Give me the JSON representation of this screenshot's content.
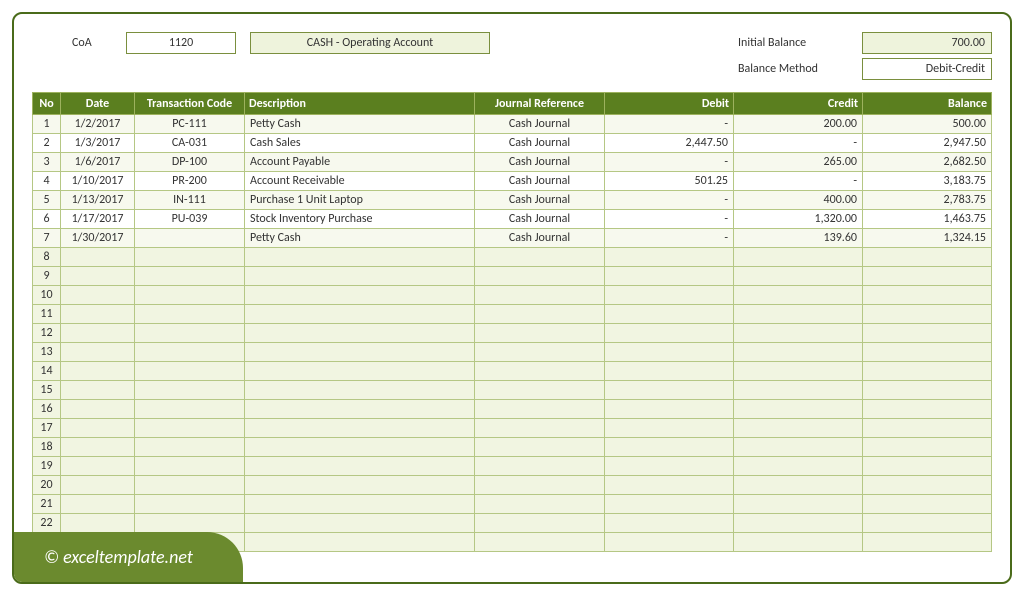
{
  "header": {
    "coa_label": "CoA",
    "coa_value": "1120",
    "account_name": "CASH - Operating Account",
    "initial_balance_label": "Initial Balance",
    "initial_balance_value": "700.00",
    "balance_method_label": "Balance Method",
    "balance_method_value": "Debit-Credit"
  },
  "columns": {
    "no": "No",
    "date": "Date",
    "tc": "Transaction Code",
    "desc": "Description",
    "jr": "Journal Reference",
    "debit": "Debit",
    "credit": "Credit",
    "balance": "Balance"
  },
  "rows": [
    {
      "no": "1",
      "date": "1/2/2017",
      "tc": "PC-111",
      "desc": "Petty Cash",
      "jr": "Cash Journal",
      "debit": "-",
      "credit": "200.00",
      "balance": "500.00"
    },
    {
      "no": "2",
      "date": "1/3/2017",
      "tc": "CA-031",
      "desc": "Cash Sales",
      "jr": "Cash Journal",
      "debit": "2,447.50",
      "credit": "-",
      "balance": "2,947.50"
    },
    {
      "no": "3",
      "date": "1/6/2017",
      "tc": "DP-100",
      "desc": "Account Payable",
      "jr": "Cash Journal",
      "debit": "-",
      "credit": "265.00",
      "balance": "2,682.50"
    },
    {
      "no": "4",
      "date": "1/10/2017",
      "tc": "PR-200",
      "desc": "Account Receivable",
      "jr": "Cash Journal",
      "debit": "501.25",
      "credit": "-",
      "balance": "3,183.75"
    },
    {
      "no": "5",
      "date": "1/13/2017",
      "tc": "IN-111",
      "desc": "Purchase 1 Unit Laptop",
      "jr": "Cash Journal",
      "debit": "-",
      "credit": "400.00",
      "balance": "2,783.75"
    },
    {
      "no": "6",
      "date": "1/17/2017",
      "tc": "PU-039",
      "desc": "Stock Inventory Purchase",
      "jr": "Cash Journal",
      "debit": "-",
      "credit": "1,320.00",
      "balance": "1,463.75"
    },
    {
      "no": "7",
      "date": "1/30/2017",
      "tc": "",
      "desc": "Petty Cash",
      "jr": "Cash Journal",
      "debit": "-",
      "credit": "139.60",
      "balance": "1,324.15"
    }
  ],
  "empty_rows_start": 8,
  "empty_rows_end": 23,
  "watermark": "© exceltemplate.net"
}
